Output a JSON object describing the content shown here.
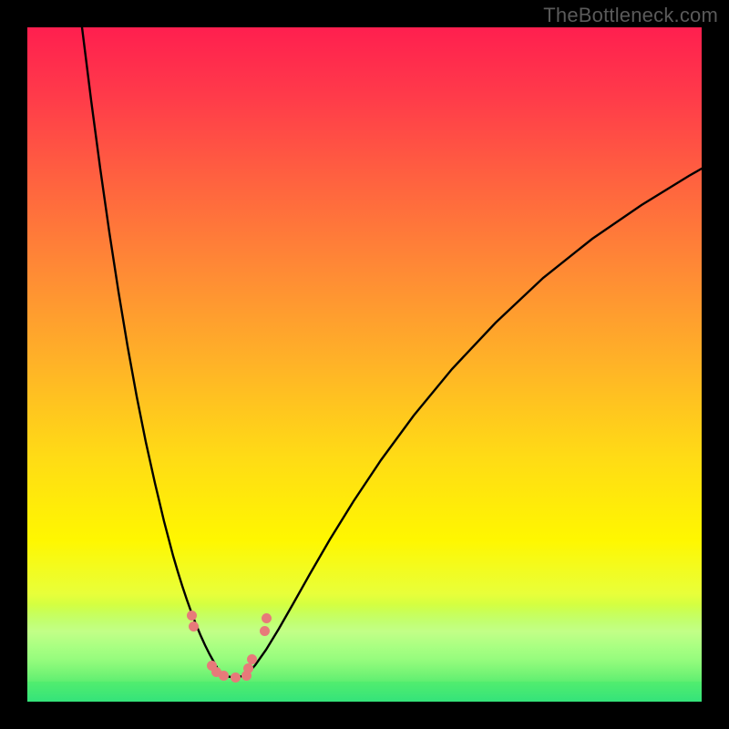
{
  "watermark": "TheBottleneck.com",
  "colors": {
    "dot": "#e77a7a",
    "curve": "#000000"
  },
  "chart_data": {
    "type": "line",
    "title": "",
    "xlabel": "",
    "ylabel": "",
    "xrange": [
      0,
      740
    ],
    "yrange_bottleneck_pct": [
      0,
      100
    ],
    "note": "x and curve y are pixel coordinates inside the 740x740 plot area (y grows downward). Background encodes bottleneck severity: top=red≈100%, bottom=green≈0%. The V-shaped curve's nadir marks the optimum (~0% bottleneck).",
    "series": [
      {
        "name": "bottleneck-curve-left",
        "x": [
          60,
          70,
          80,
          90,
          100,
          110,
          120,
          130,
          140,
          150,
          160,
          165,
          170,
          175,
          180,
          185,
          190,
          195,
          200,
          205,
          210,
          212
        ],
        "y": [
          0,
          80,
          155,
          225,
          290,
          350,
          405,
          455,
          500,
          542,
          580,
          597,
          613,
          628,
          642,
          655,
          667,
          678,
          688,
          697,
          706,
          710
        ]
      },
      {
        "name": "bottleneck-curve-flat",
        "x": [
          212,
          218,
          224,
          230,
          236,
          240
        ],
        "y": [
          710,
          712,
          713,
          713,
          712,
          711
        ]
      },
      {
        "name": "bottleneck-curve-right",
        "x": [
          240,
          250,
          262,
          276,
          292,
          310,
          332,
          358,
          388,
          424,
          466,
          514,
          566,
          620,
          674,
          726,
          740
        ],
        "y": [
          711,
          700,
          683,
          660,
          632,
          600,
          562,
          520,
          475,
          426,
          375,
          324,
          275,
          232,
          195,
          163,
          155
        ]
      },
      {
        "name": "sample-dots",
        "x": [
          180,
          182,
          202,
          207,
          215,
          228,
          240,
          242,
          246,
          260,
          262
        ],
        "y": [
          645,
          657,
          700,
          707,
          711,
          713,
          711,
          703,
          693,
          662,
          648
        ]
      }
    ]
  }
}
